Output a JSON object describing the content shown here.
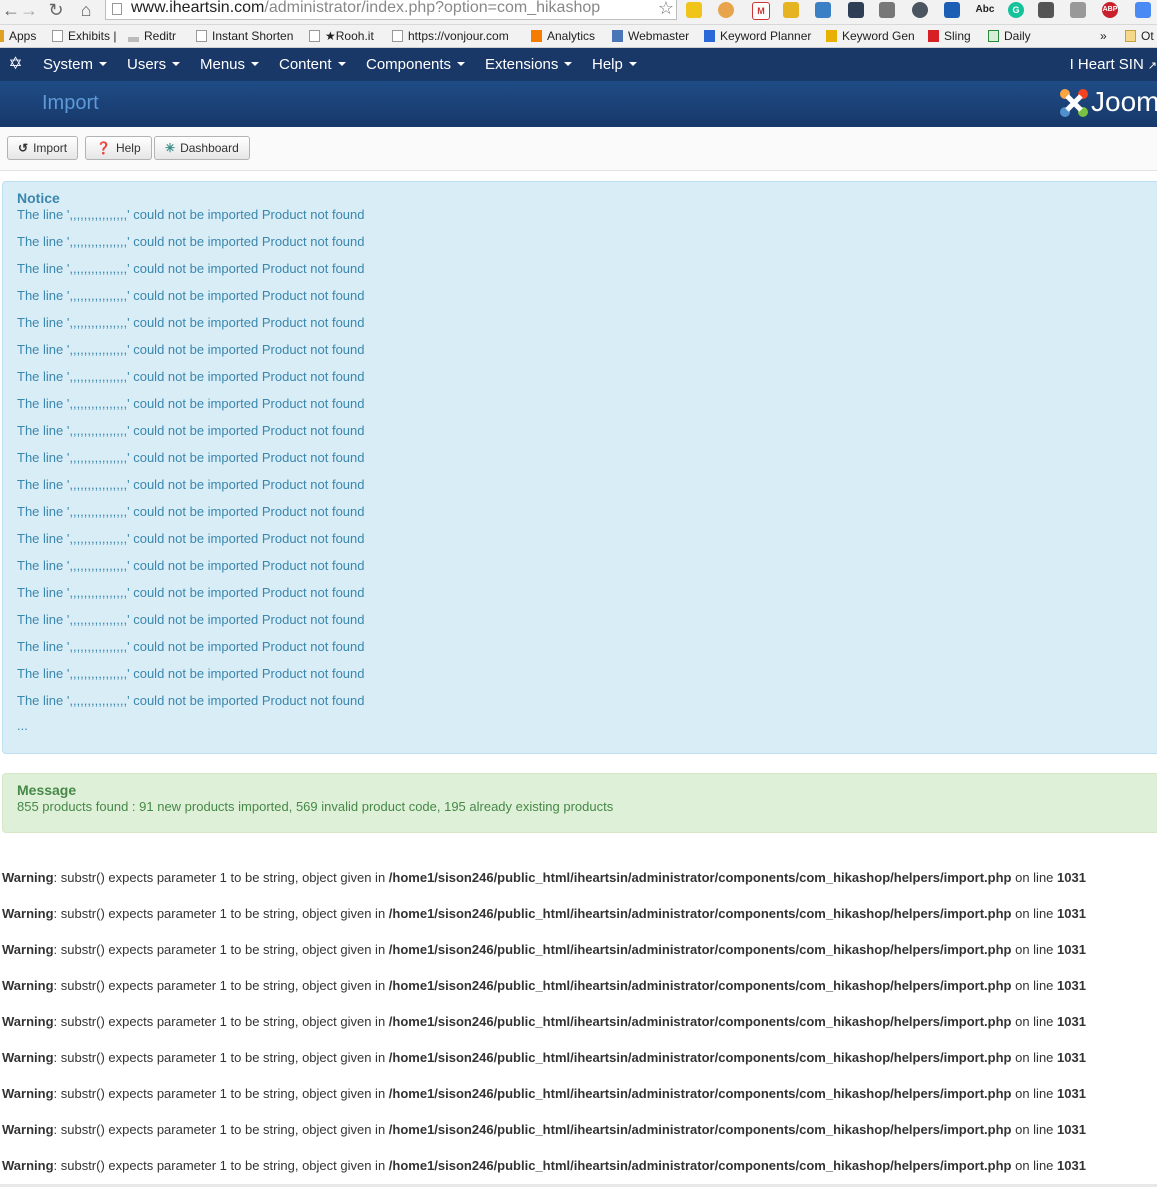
{
  "browser": {
    "url_host": "www.iheartsin.com",
    "url_rest": "/administrator/index.php?option=com_hikashop",
    "bookmarks": [
      {
        "label": "Apps"
      },
      {
        "label": "Exhibits |"
      },
      {
        "label": "Reditr"
      },
      {
        "label": "Instant Shorten"
      },
      {
        "label": "★Rooh.it"
      },
      {
        "label": "https://vonjour.com"
      },
      {
        "label": "Analytics"
      },
      {
        "label": "Webmaster"
      },
      {
        "label": "Keyword Planner"
      },
      {
        "label": "Keyword Gen"
      },
      {
        "label": "Sling"
      },
      {
        "label": "Daily"
      },
      {
        "label": "»"
      },
      {
        "label": "Ot"
      }
    ],
    "extension_badges": {
      "abc": "Abc",
      "abp": "ABP",
      "g": "G"
    }
  },
  "topnav": {
    "menus": [
      "System",
      "Users",
      "Menus",
      "Content",
      "Components",
      "Extensions",
      "Help"
    ],
    "site_name": "I Heart SIN"
  },
  "titlebar": {
    "title": "Import",
    "brand": "Joomla!"
  },
  "toolbar": {
    "import_label": "Import",
    "help_label": "Help",
    "dashboard_label": "Dashboard"
  },
  "notice": {
    "heading": "Notice",
    "lines": [
      "The line ',,,,,,,,,,,,,,,,' could not be imported Product not found",
      "The line ',,,,,,,,,,,,,,,,' could not be imported Product not found",
      "The line ',,,,,,,,,,,,,,,,' could not be imported Product not found",
      "The line ',,,,,,,,,,,,,,,,' could not be imported Product not found",
      "The line ',,,,,,,,,,,,,,,,' could not be imported Product not found",
      "The line ',,,,,,,,,,,,,,,,' could not be imported Product not found",
      "The line ',,,,,,,,,,,,,,,,' could not be imported Product not found",
      "The line ',,,,,,,,,,,,,,,,' could not be imported Product not found",
      "The line ',,,,,,,,,,,,,,,,' could not be imported Product not found",
      "The line ',,,,,,,,,,,,,,,,' could not be imported Product not found",
      "The line ',,,,,,,,,,,,,,,,' could not be imported Product not found",
      "The line ',,,,,,,,,,,,,,,,' could not be imported Product not found",
      "The line ',,,,,,,,,,,,,,,,' could not be imported Product not found",
      "The line ',,,,,,,,,,,,,,,,' could not be imported Product not found",
      "The line ',,,,,,,,,,,,,,,,' could not be imported Product not found",
      "The line ',,,,,,,,,,,,,,,,' could not be imported Product not found",
      "The line ',,,,,,,,,,,,,,,,' could not be imported Product not found",
      "The line ',,,,,,,,,,,,,,,,' could not be imported Product not found",
      "The line ',,,,,,,,,,,,,,,,' could not be imported Product not found"
    ],
    "more": "..."
  },
  "message": {
    "heading": "Message",
    "body": "855 products found : 91 new products imported, 569 invalid product code, 195 already existing products"
  },
  "warnings": {
    "label": "Warning",
    "text": ": substr() expects parameter 1 to be string, object given in ",
    "path": "/home1/sison246/public_html/iheartsin/administrator/components/com_hikashop/helpers/import.php",
    "online": " on line ",
    "line_no": "1031",
    "count": 9
  },
  "colors": {
    "nav_bg": "#1a3867",
    "notice_bg": "#d9edf7",
    "notice_text": "#3a87ad",
    "message_bg": "#dff0d8",
    "message_text": "#468847"
  }
}
